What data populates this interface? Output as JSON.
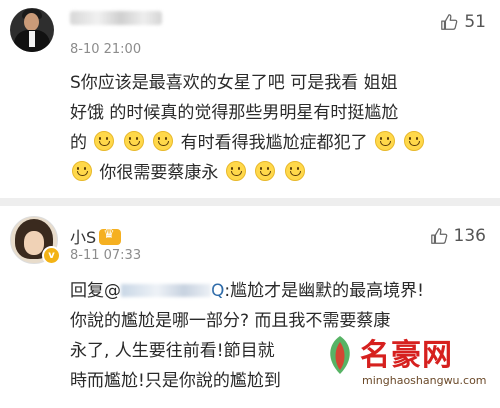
{
  "comments": [
    {
      "username_visible": false,
      "time": "8-10 21:00",
      "likes": "51",
      "text": [
        "S你应该是最喜欢的女星了吧 可是我看 姐姐",
        "好饿 的时候真的觉得那些男明星有时挺尴尬",
        "的",
        "有时看得我尴尬症都犯了",
        "你很需要蔡康永"
      ],
      "emoji": "smile-emoji"
    },
    {
      "username": "小S",
      "time": "8-11 07:33",
      "likes": "136",
      "verified_icon": "v-badge",
      "reply_prefix": "回复@",
      "reply_mention_tail": "Q",
      "text": [
        ":尴尬才是幽默的最高境界!",
        "你說的尷尬是哪一部分? 而且我不需要蔡康",
        "永了, 人生要往前看!節目就",
        "時而尷尬!只是你說的尷尬到"
      ]
    }
  ],
  "watermark": {
    "title": "名豪网",
    "url": "minghaoshangwu.com"
  },
  "colors": {
    "mention": "#2d6aa8",
    "watermark_red": "#d6201e",
    "badge": "#f3b316"
  }
}
